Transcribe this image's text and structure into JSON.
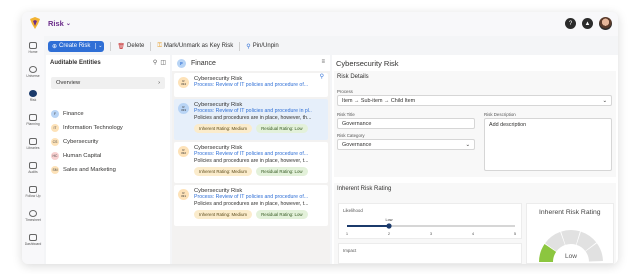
{
  "app": {
    "module_title": "Risk",
    "module_chevron": "⌄",
    "logo_icon": "app-logo-icon",
    "colors": {
      "accent": "#2f6fd6",
      "brand_purple": "#6b2d8a",
      "sidebar_active": "#1b3a6b"
    }
  },
  "rail": {
    "items": [
      {
        "label": "Home",
        "icon": "home-icon"
      },
      {
        "label": "Universe",
        "icon": "globe-icon"
      },
      {
        "label": "Risk",
        "icon": "risk-icon"
      },
      {
        "label": "Planning",
        "icon": "planning-icon"
      },
      {
        "label": "Libraries",
        "icon": "library-icon"
      },
      {
        "label": "Audits",
        "icon": "audit-icon"
      },
      {
        "label": "Follow Up",
        "icon": "follow-up-icon"
      },
      {
        "label": "Timesheet",
        "icon": "timesheet-icon"
      },
      {
        "label": "Dashboard",
        "icon": "dashboard-icon"
      }
    ]
  },
  "toolbar": {
    "create_label": "Create Risk",
    "delete_label": "Delete",
    "mark_label": "Mark/Unmark as Key Risk",
    "pin_label": "Pin/Unpin"
  },
  "entities": {
    "title": "Auditable Entities",
    "overview": "Overview",
    "items": [
      {
        "label": "Finance",
        "badge": "F",
        "color": "#b8d4f5"
      },
      {
        "label": "Information Technology",
        "badge": "IT",
        "color": "#fde2b8"
      },
      {
        "label": "Cybersecurity",
        "badge": "CS",
        "color": "#fde2b8"
      },
      {
        "label": "Human Capital",
        "badge": "HC",
        "color": "#f8d0d0"
      },
      {
        "label": "Sales and Marketing",
        "badge": "SM",
        "color": "#fde2b8"
      }
    ]
  },
  "list": {
    "title": "Finance",
    "badge": "F",
    "cards": [
      {
        "badge_top": "R",
        "badge_num": "334",
        "title": "Cybersecurity Risk",
        "process": "Process: Review of IT policies and procedure of...",
        "desc": "",
        "inherent": "",
        "residual": ""
      },
      {
        "badge_top": "R",
        "badge_num": "333",
        "title": "Cybersecurity Risk",
        "process": "Process: Review of IT policies and procedure in pl..",
        "desc": "Policies and procedures are in place, however, th...",
        "inherent": "Inherent Rating: Medium",
        "residual": "Residual Rating: Low"
      },
      {
        "badge_top": "R",
        "badge_num": "332",
        "title": "Cybersecurity Risk",
        "process": "Process: Review of IT policies and procedure of...",
        "desc": "Policies and procedures are in place, however, t...",
        "inherent": "Inherent Rating: Medium",
        "residual": "Residual Rating: Low"
      },
      {
        "badge_top": "R",
        "badge_num": "331",
        "title": "Cybersecurity Risk",
        "process": "Process: Review of IT policies and procedure of...",
        "desc": "Policies and procedures are in place, however, t...",
        "inherent": "Inherent Rating: Medium",
        "residual": "Residual Rating: Low"
      }
    ]
  },
  "detail": {
    "title": "Cybersecurity Risk",
    "risk_details_title": "Risk Details",
    "process_label": "Process",
    "process_value": "Item → Sub-item → Child Item",
    "risk_title_label": "Risk Title",
    "risk_title_value": "Governance",
    "risk_desc_label": "Risk Description",
    "risk_desc_placeholder": "Add description",
    "risk_category_label": "Risk Category",
    "risk_category_value": "Governance",
    "inherent_title": "Inherent Risk Rating",
    "likelihood_label": "Likelihood",
    "likelihood_value": 2,
    "likelihood_tooltip": "Low",
    "slider_ticks": [
      "1",
      "2",
      "3",
      "4",
      "5"
    ],
    "impact_label": "Impact",
    "gauge_title": "Inherent Risk Rating",
    "gauge_value_label": "Low",
    "gauge_fraction": 0.2
  }
}
